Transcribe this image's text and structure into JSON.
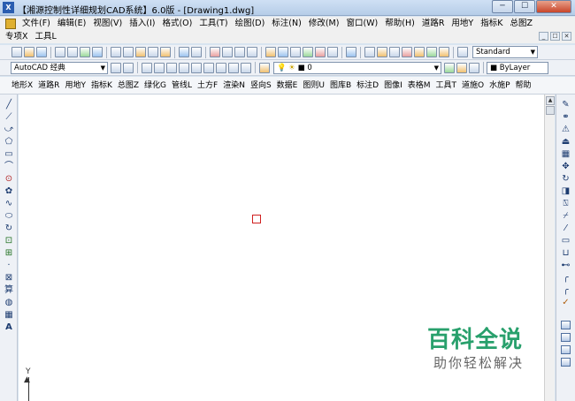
{
  "window": {
    "title": "【湘源控制性详细规划CAD系统】6.0版 - [Drawing1.dwg]",
    "minimize_glyph": "─",
    "maximize_glyph": "☐",
    "close_glyph": "✕"
  },
  "menubar": {
    "items": [
      "文件(F)",
      "编辑(E)",
      "视图(V)",
      "插入(I)",
      "格式(O)",
      "工具(T)",
      "绘图(D)",
      "标注(N)",
      "修改(M)",
      "窗口(W)",
      "帮助(H)",
      "道路R",
      "用地Y",
      "指标K",
      "总图Z"
    ],
    "row2": [
      "专项X",
      "工具L"
    ],
    "mdi": [
      "_",
      "☐",
      "✕"
    ]
  },
  "toolbar2": {
    "workspace": "AutoCAD 经典",
    "layer": "0",
    "text_style": "Standard",
    "linetype": "■ ByLayer"
  },
  "custom_menu": {
    "items": [
      "地形X",
      "道路R",
      "用地Y",
      "指标K",
      "总图Z",
      "绿化G",
      "管线L",
      "土方F",
      "渲染N",
      "竖向S",
      "数据E",
      "图则U",
      "图库B",
      "标注D",
      "图像I",
      "表格M",
      "工具T",
      "道施O",
      "水施P",
      "帮助"
    ]
  },
  "left_tools": [
    "╱",
    "⟋",
    "⤻",
    "⬠",
    "▭",
    "⌒",
    "⊙",
    "✿",
    "∿",
    "⬭",
    "↻",
    "⊡",
    "⊞",
    "·",
    "⊠",
    "算",
    "◍",
    "▦",
    "A"
  ],
  "right_tools": [
    "✎",
    "⚭",
    "⚠",
    "⏏",
    "▦",
    "✥",
    "↻",
    "◨",
    "⍂",
    "⌿",
    "⁄",
    "▭",
    "⊔",
    "⊷",
    "╭",
    "╭",
    "✓"
  ],
  "canvas": {
    "ucs_label": "Y",
    "ucs_arrow": "▲"
  },
  "scroll": {
    "up_glyph": "▲"
  },
  "watermark": {
    "title": "百科全说",
    "subtitle": "助你轻松解决"
  },
  "colors": {
    "watermark_green": "#28a06c",
    "pickbox_red": "#d02020"
  }
}
